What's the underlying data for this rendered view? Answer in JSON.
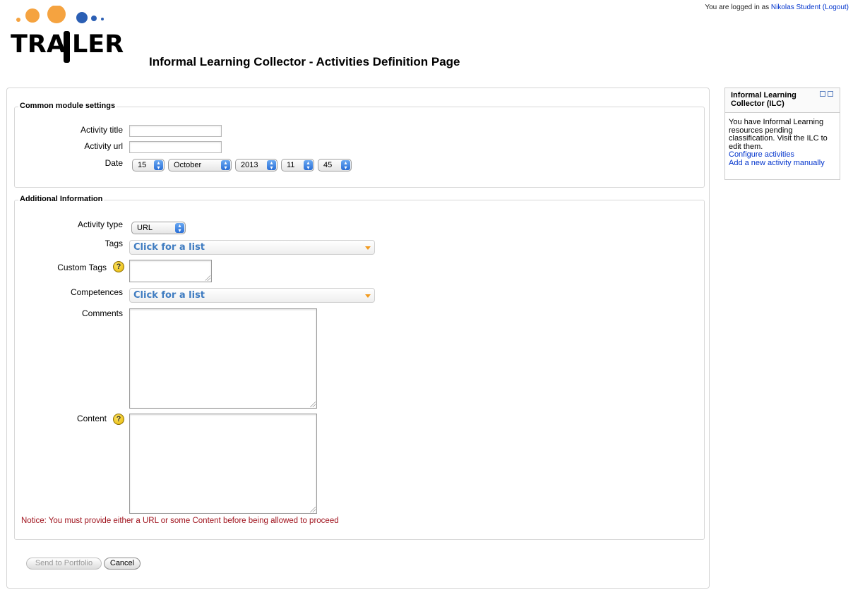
{
  "header": {
    "login_prefix": "You are logged in as",
    "user_name": "Nikolas Student",
    "logout": "(Logout)",
    "logo_text": "TRAILER",
    "page_title": "Informal Learning Collector - Activities Definition Page"
  },
  "common": {
    "legend": "Common module settings",
    "activity_title_label": "Activity title",
    "activity_title_value": "",
    "activity_url_label": "Activity url",
    "activity_url_value": "",
    "date_label": "Date",
    "date": {
      "day": "15",
      "month": "October",
      "year": "2013",
      "hour": "11",
      "minute": "45"
    }
  },
  "additional": {
    "legend": "Additional Information",
    "activity_type_label": "Activity type",
    "activity_type_value": "URL",
    "tags_label": "Tags",
    "tags_placeholder": "Click for a list",
    "custom_tags_label": "Custom Tags",
    "competences_label": "Competences",
    "competences_placeholder": "Click for a list",
    "comments_label": "Comments",
    "content_label": "Content",
    "help_glyph": "?"
  },
  "notice": "Notice: You must provide either a URL or some Content before being allowed to proceed",
  "buttons": {
    "send": "Send to Portfolio",
    "cancel": "Cancel"
  },
  "block": {
    "title": "Informal Learning Collector (ILC)",
    "message": "You have Informal Learning resources pending classification. Visit the ILC to edit them.",
    "links": [
      "Configure activities",
      "Add a new activity manually"
    ]
  },
  "colors": {
    "link": "#0033cc",
    "notice": "#a0141e",
    "logo_orange": "#f5a340",
    "logo_blue": "#2b5fb4"
  }
}
